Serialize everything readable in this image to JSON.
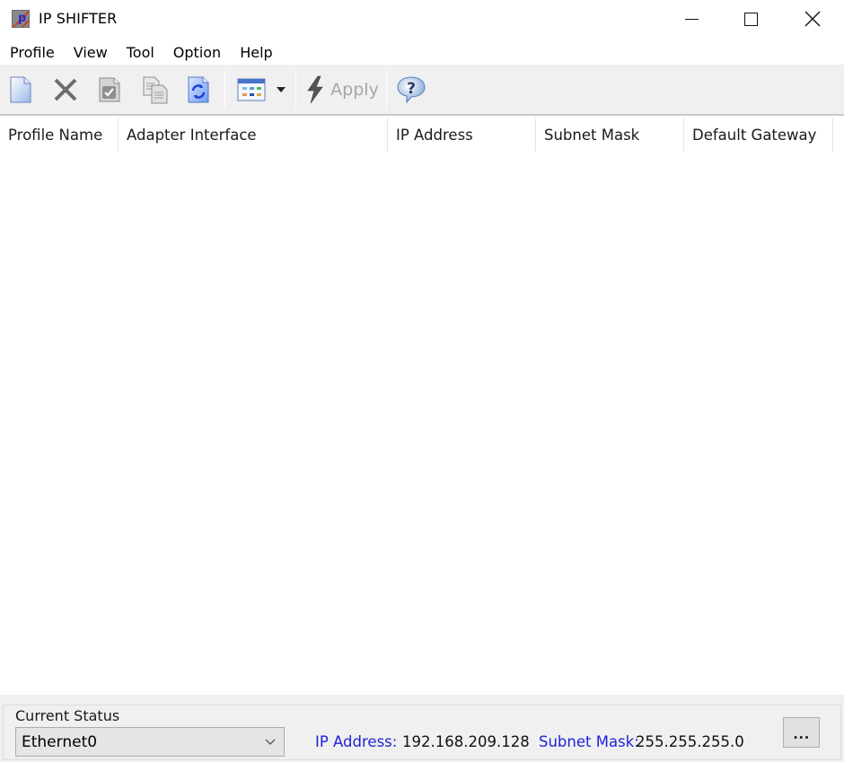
{
  "window": {
    "title": "IP SHIFTER",
    "app_icon": "ip-shifter-app-icon",
    "controls": [
      "minimize-icon",
      "maximize-icon",
      "close-icon"
    ]
  },
  "menu": {
    "items": [
      {
        "label": "Profile"
      },
      {
        "label": "View"
      },
      {
        "label": "Tool"
      },
      {
        "label": "Option"
      },
      {
        "label": "Help"
      }
    ]
  },
  "toolbar": {
    "buttons": [
      {
        "icon": "new-profile-icon",
        "enabled": true
      },
      {
        "icon": "delete-icon",
        "enabled": false
      },
      {
        "icon": "edit-profile-icon",
        "enabled": false
      },
      {
        "icon": "copy-profile-icon",
        "enabled": false
      },
      {
        "icon": "refresh-icon",
        "enabled": true
      },
      {
        "icon": "view-mode-icon",
        "enabled": true
      },
      {
        "icon": "dropdown-arrow-icon",
        "enabled": true
      },
      {
        "icon": "lightning-icon",
        "enabled": false
      },
      {
        "icon": "help-icon",
        "enabled": true
      }
    ],
    "apply_label": "Apply"
  },
  "profile_list": {
    "columns": [
      {
        "label": "Profile Name"
      },
      {
        "label": "Adapter Interface"
      },
      {
        "label": "IP Address"
      },
      {
        "label": "Subnet Mask"
      },
      {
        "label": "Default Gateway"
      }
    ],
    "rows": []
  },
  "current_status": {
    "group_label": "Current Status",
    "adapter_selected": "Ethernet0",
    "ip_label": "IP Address:",
    "ip_value": "192.168.209.128",
    "mask_label": "Subnet Mask:",
    "mask_value": "255.255.255.0",
    "more_button_label": "..."
  },
  "colors": {
    "status_label": "#1f1fd8",
    "toolbar_bg": "#f0f0f0",
    "disabled_text": "#a6a6a6"
  }
}
